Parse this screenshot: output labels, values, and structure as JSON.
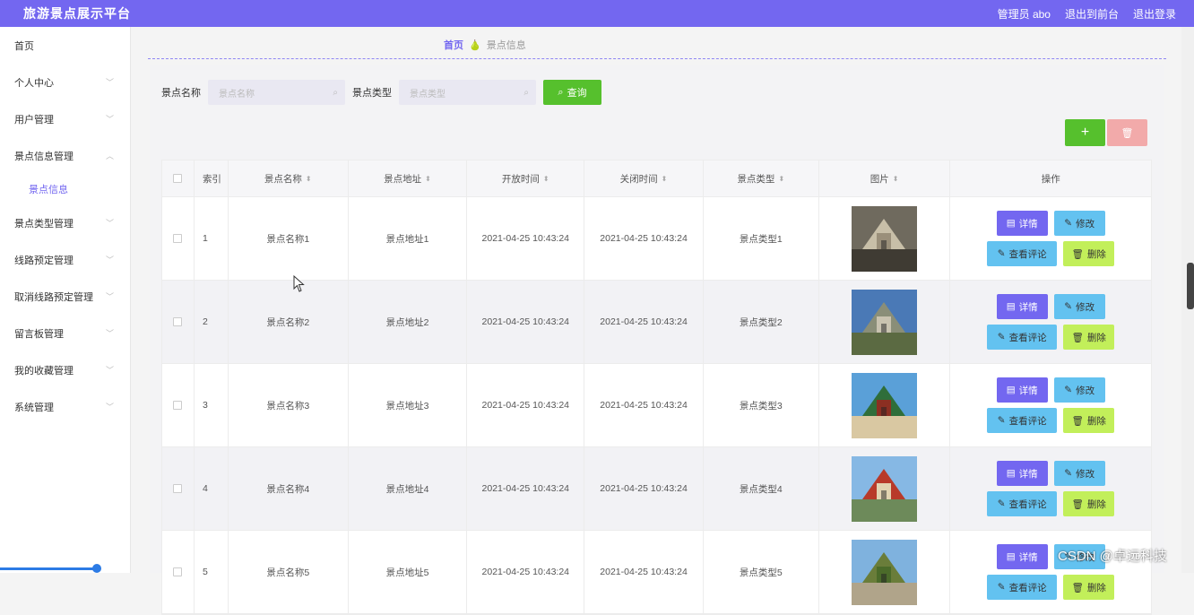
{
  "header": {
    "title": "旅游景点展示平台",
    "admin_label": "管理员 abo",
    "frontend_link": "退出到前台",
    "logout_link": "退出登录"
  },
  "sidebar": {
    "items": [
      {
        "label": "首页",
        "has_chevron": false
      },
      {
        "label": "个人中心",
        "has_chevron": true
      },
      {
        "label": "用户管理",
        "has_chevron": true
      },
      {
        "label": "景点信息管理",
        "has_chevron": true,
        "expanded": true
      },
      {
        "label": "景点类型管理",
        "has_chevron": true
      },
      {
        "label": "线路预定管理",
        "has_chevron": true
      },
      {
        "label": "取消线路预定管理",
        "has_chevron": true
      },
      {
        "label": "留言板管理",
        "has_chevron": true
      },
      {
        "label": "我的收藏管理",
        "has_chevron": true
      },
      {
        "label": "系统管理",
        "has_chevron": true
      }
    ],
    "subitem": "景点信息"
  },
  "breadcrumb": {
    "home": "首页",
    "current": "景点信息"
  },
  "search": {
    "name_label": "景点名称",
    "name_placeholder": "景点名称",
    "type_label": "景点类型",
    "type_placeholder": "景点类型",
    "query_button": "查询"
  },
  "toolbar": {
    "add_icon": "+",
    "delete_icon": "trash-icon"
  },
  "table": {
    "headers": [
      "索引",
      "景点名称",
      "景点地址",
      "开放时间",
      "关闭时间",
      "景点类型",
      "图片",
      "操作"
    ],
    "rows": [
      {
        "index": "1",
        "name": "景点名称1",
        "address": "景点地址1",
        "open": "2021-04-25 10:43:24",
        "close": "2021-04-25 10:43:24",
        "type": "景点类型1"
      },
      {
        "index": "2",
        "name": "景点名称2",
        "address": "景点地址2",
        "open": "2021-04-25 10:43:24",
        "close": "2021-04-25 10:43:24",
        "type": "景点类型2"
      },
      {
        "index": "3",
        "name": "景点名称3",
        "address": "景点地址3",
        "open": "2021-04-25 10:43:24",
        "close": "2021-04-25 10:43:24",
        "type": "景点类型3"
      },
      {
        "index": "4",
        "name": "景点名称4",
        "address": "景点地址4",
        "open": "2021-04-25 10:43:24",
        "close": "2021-04-25 10:43:24",
        "type": "景点类型4"
      },
      {
        "index": "5",
        "name": "景点名称5",
        "address": "景点地址5",
        "open": "2021-04-25 10:43:24",
        "close": "2021-04-25 10:43:24",
        "type": "景点类型5"
      }
    ],
    "actions": {
      "detail": "详情",
      "edit": "修改",
      "review": "查看评论",
      "delete": "删除"
    }
  },
  "watermark": "CSDN @卓远科技",
  "colors": {
    "primary": "#7367f0",
    "success": "#56c02d",
    "danger_light": "#f2aaaa",
    "info": "#63c2f0",
    "lime": "#c2ef5a"
  }
}
